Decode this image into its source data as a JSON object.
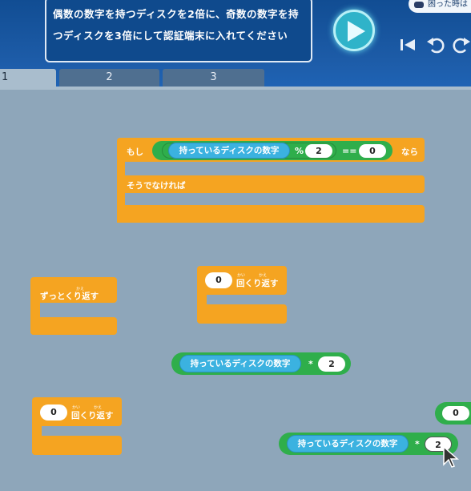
{
  "instruction": {
    "line1": "偶数の数字を持つディスクを2倍に、奇数の数字を持",
    "line2": "つディスクを3倍にして認証端末に入れてください"
  },
  "help_label": "困った時は",
  "tabs": [
    {
      "label": "1"
    },
    {
      "label": "2"
    },
    {
      "label": "3"
    }
  ],
  "blocks": {
    "if_else": {
      "if_label": "もし",
      "then_label": "なら",
      "else_label": "そうでなければ",
      "variable": "持っているディスクの数字",
      "mod_op": "%",
      "mod_value": "2",
      "eq_op": "==",
      "eq_value": "0"
    },
    "forever": {
      "label": "ずっとくり返す",
      "ruby": "かえ"
    },
    "repeat_a": {
      "count": "0",
      "label": "回くり返す",
      "ruby1": "かい",
      "ruby2": "かえ"
    },
    "multiply_a": {
      "variable": "持っているディスクの数字",
      "op": "*",
      "value": "2"
    },
    "repeat_b": {
      "count": "0",
      "label": "回くり返す",
      "ruby1": "かい",
      "ruby2": "かえ"
    },
    "number_block": {
      "value": "0"
    },
    "multiply_b": {
      "variable": "持っているディスクの数字",
      "op": "*",
      "value": "2"
    }
  },
  "colors": {
    "control": "#f5a421",
    "operator": "#2fae4b",
    "variable": "#3bb2e0",
    "workspace": "#8ea6ba",
    "header": "#1a579f"
  }
}
